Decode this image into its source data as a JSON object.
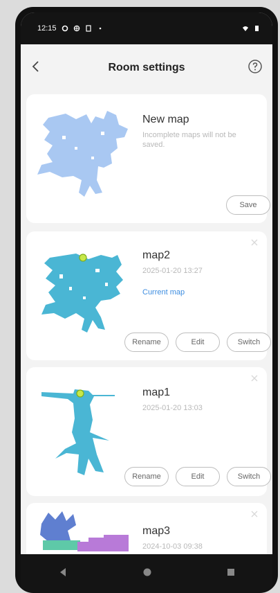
{
  "status": {
    "time": "12:15"
  },
  "header": {
    "title": "Room settings"
  },
  "new_map": {
    "name": "New map",
    "note": "Incomplete maps will not be saved.",
    "save_label": "Save"
  },
  "map2": {
    "name": "map2",
    "date": "2025-01-20 13:27",
    "current_label": "Current map",
    "rename_label": "Rename",
    "edit_label": "Edit",
    "switch_label": "Switch"
  },
  "map1": {
    "name": "map1",
    "date": "2025-01-20 13:03",
    "rename_label": "Rename",
    "edit_label": "Edit",
    "switch_label": "Switch"
  },
  "map3": {
    "name": "map3",
    "date": "2024-10-03 09:38"
  },
  "colors": {
    "accent": "#3d8de0",
    "new_map_fill": "#a9c8f2",
    "map_fill": "#4ab6d4"
  }
}
